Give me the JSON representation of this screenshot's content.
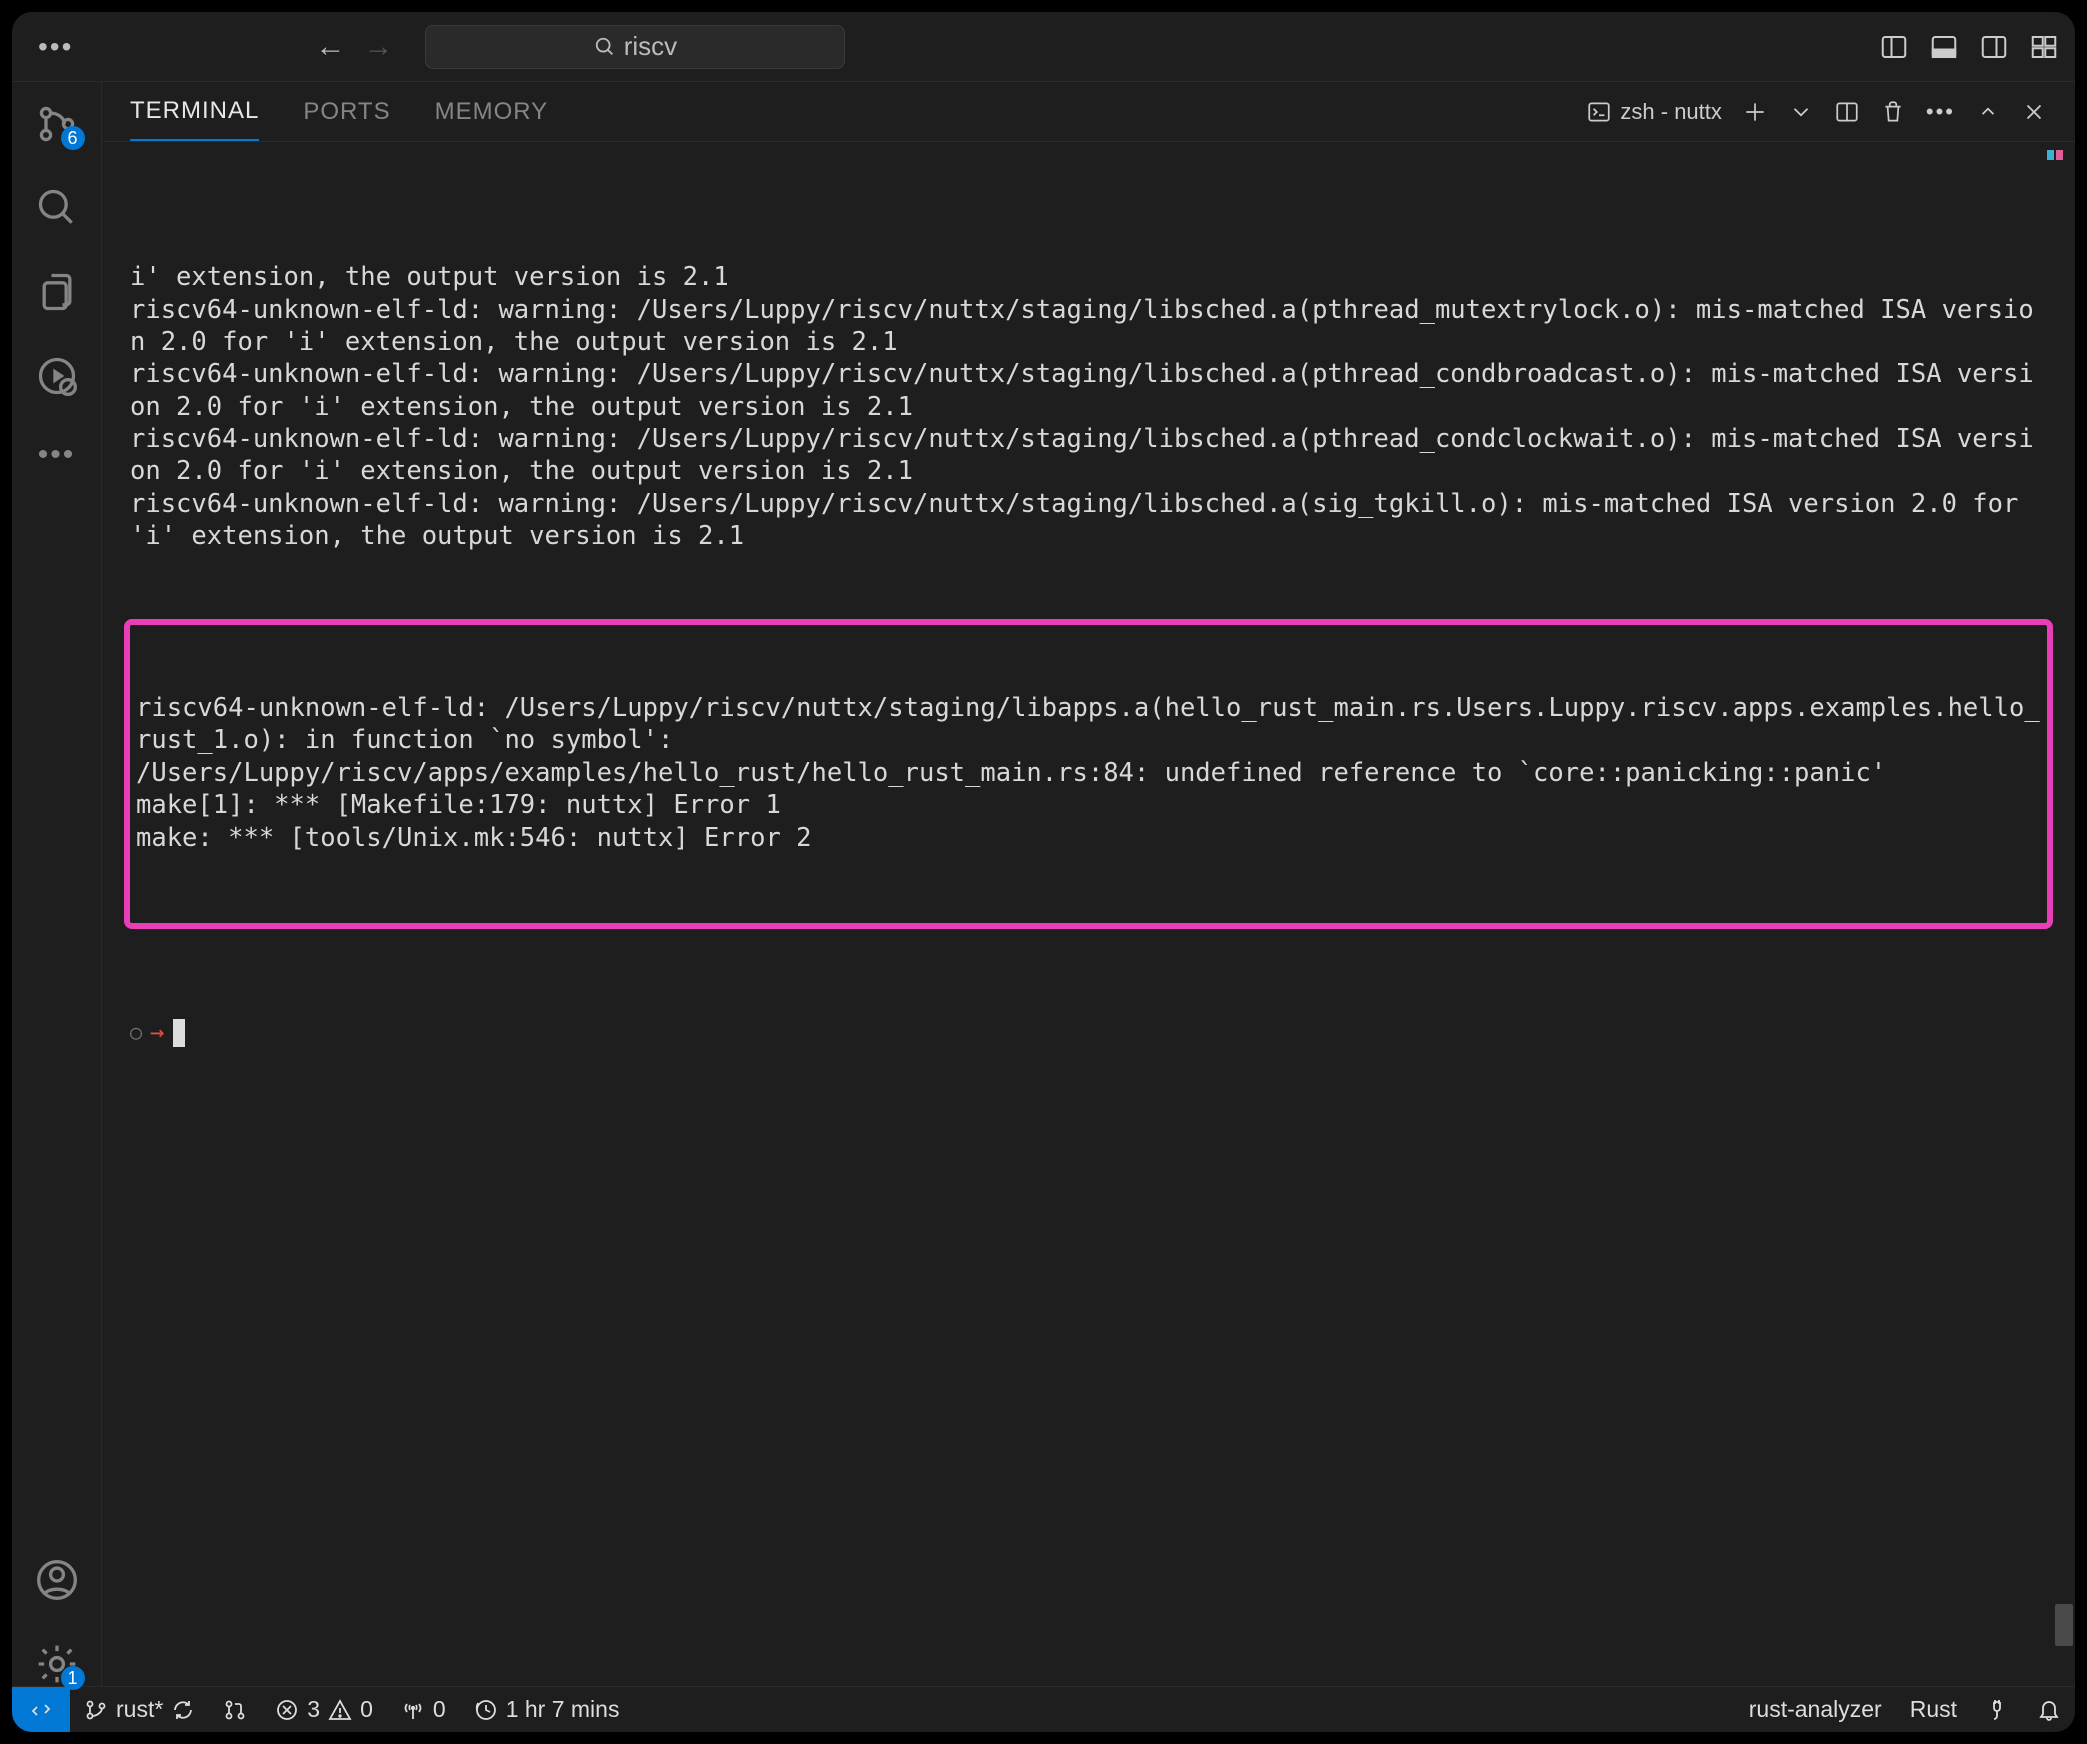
{
  "titlebar": {
    "search_value": "riscv"
  },
  "activitybar": {
    "scm_badge": "6",
    "settings_badge": "1"
  },
  "panel": {
    "tabs": {
      "terminal": "TERMINAL",
      "ports": "PORTS",
      "memory": "MEMORY"
    },
    "terminal_name": "zsh - nuttx"
  },
  "terminal": {
    "pre_lines": "i' extension, the output version is 2.1\nriscv64-unknown-elf-ld: warning: /Users/Luppy/riscv/nuttx/staging/libsched.a(pthread_mutextrylock.o): mis-matched ISA version 2.0 for 'i' extension, the output version is 2.1\nriscv64-unknown-elf-ld: warning: /Users/Luppy/riscv/nuttx/staging/libsched.a(pthread_condbroadcast.o): mis-matched ISA version 2.0 for 'i' extension, the output version is 2.1\nriscv64-unknown-elf-ld: warning: /Users/Luppy/riscv/nuttx/staging/libsched.a(pthread_condclockwait.o): mis-matched ISA version 2.0 for 'i' extension, the output version is 2.1\nriscv64-unknown-elf-ld: warning: /Users/Luppy/riscv/nuttx/staging/libsched.a(sig_tgkill.o): mis-matched ISA version 2.0 for 'i' extension, the output version is 2.1",
    "highlight_lines": "riscv64-unknown-elf-ld: /Users/Luppy/riscv/nuttx/staging/libapps.a(hello_rust_main.rs.Users.Luppy.riscv.apps.examples.hello_rust_1.o): in function `no symbol':\n/Users/Luppy/riscv/apps/examples/hello_rust/hello_rust_main.rs:84: undefined reference to `core::panicking::panic'\nmake[1]: *** [Makefile:179: nuttx] Error 1\nmake: *** [tools/Unix.mk:546: nuttx] Error 2"
  },
  "statusbar": {
    "branch": "rust*",
    "errors": "3",
    "warnings": "0",
    "radio": "0",
    "time": "1 hr 7 mins",
    "rust_analyzer": "rust-analyzer",
    "lang": "Rust"
  }
}
